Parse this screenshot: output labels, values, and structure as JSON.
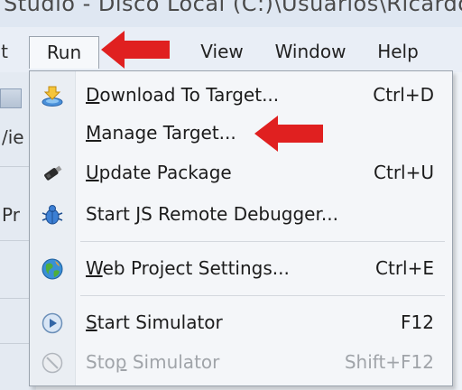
{
  "titlebar": {
    "text": "Studio - Disco Local (C:)\\Usuarios\\Ricardo Olive"
  },
  "menubar": {
    "partial_label": "t",
    "run_label": "Run",
    "view_label": "View",
    "window_label": "Window",
    "help_label": "Help"
  },
  "left_strip": {
    "text_1": "/ie",
    "text_2": "Pr"
  },
  "menu": {
    "items": [
      {
        "pre": "",
        "u": "D",
        "post": "ownload To Target...",
        "shortcut": "Ctrl+D",
        "icon": "download-target-icon",
        "enabled": true
      },
      {
        "pre": "",
        "u": "M",
        "post": "anage Target...",
        "shortcut": "",
        "icon": "",
        "enabled": true
      },
      {
        "pre": "",
        "u": "U",
        "post": "pdate Package",
        "shortcut": "Ctrl+U",
        "icon": "usb-drive-icon",
        "enabled": true
      },
      {
        "pre": "Start ",
        "u": "J",
        "post": "S Remote Debugger...",
        "shortcut": "",
        "icon": "bug-icon",
        "enabled": true
      },
      {
        "pre": "",
        "u": "W",
        "post": "eb Project Settings...",
        "shortcut": "Ctrl+E",
        "icon": "globe-icon",
        "enabled": true
      },
      {
        "pre": "",
        "u": "S",
        "post": "tart Simulator",
        "shortcut": "F12",
        "icon": "play-icon",
        "enabled": true
      },
      {
        "pre": "Sto",
        "u": "p",
        "post": " Simulator",
        "shortcut": "Shift+F12",
        "icon": "stop-icon",
        "enabled": false
      }
    ]
  },
  "colors": {
    "arrow": "#e02020",
    "menu_bg": "#f4f6f9",
    "disabled_text": "#a0a4a9"
  }
}
